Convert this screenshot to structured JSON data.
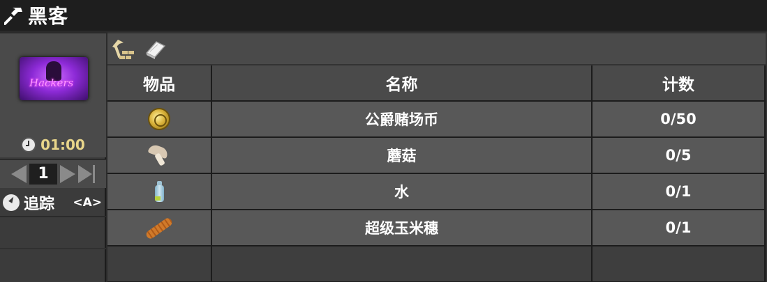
{
  "window": {
    "title": "黑客",
    "title_icon": "hammer-icon"
  },
  "quest": {
    "poster_text": "Hackers",
    "timer": "01:00",
    "timer_icon": "clock-icon"
  },
  "pager": {
    "page": "1"
  },
  "tracking": {
    "label": "追踪",
    "key": "<A>",
    "icon": "compass-icon"
  },
  "toolbar": {
    "icons": [
      "crafting-icon",
      "book-icon"
    ]
  },
  "table": {
    "headers": {
      "item": "物品",
      "name": "名称",
      "count": "计数"
    },
    "rows": [
      {
        "icon": "coin-icon",
        "name": "公爵赌场币",
        "count": "0/50"
      },
      {
        "icon": "mushroom-icon",
        "name": "蘑菇",
        "count": "0/5"
      },
      {
        "icon": "water-bottle-icon",
        "name": "水",
        "count": "0/1"
      },
      {
        "icon": "corn-cob-icon",
        "name": "超级玉米穗",
        "count": "0/1"
      }
    ]
  },
  "colors": {
    "timer": "#e8d58a",
    "background": "#2b2b2b",
    "cell": "#585858"
  }
}
